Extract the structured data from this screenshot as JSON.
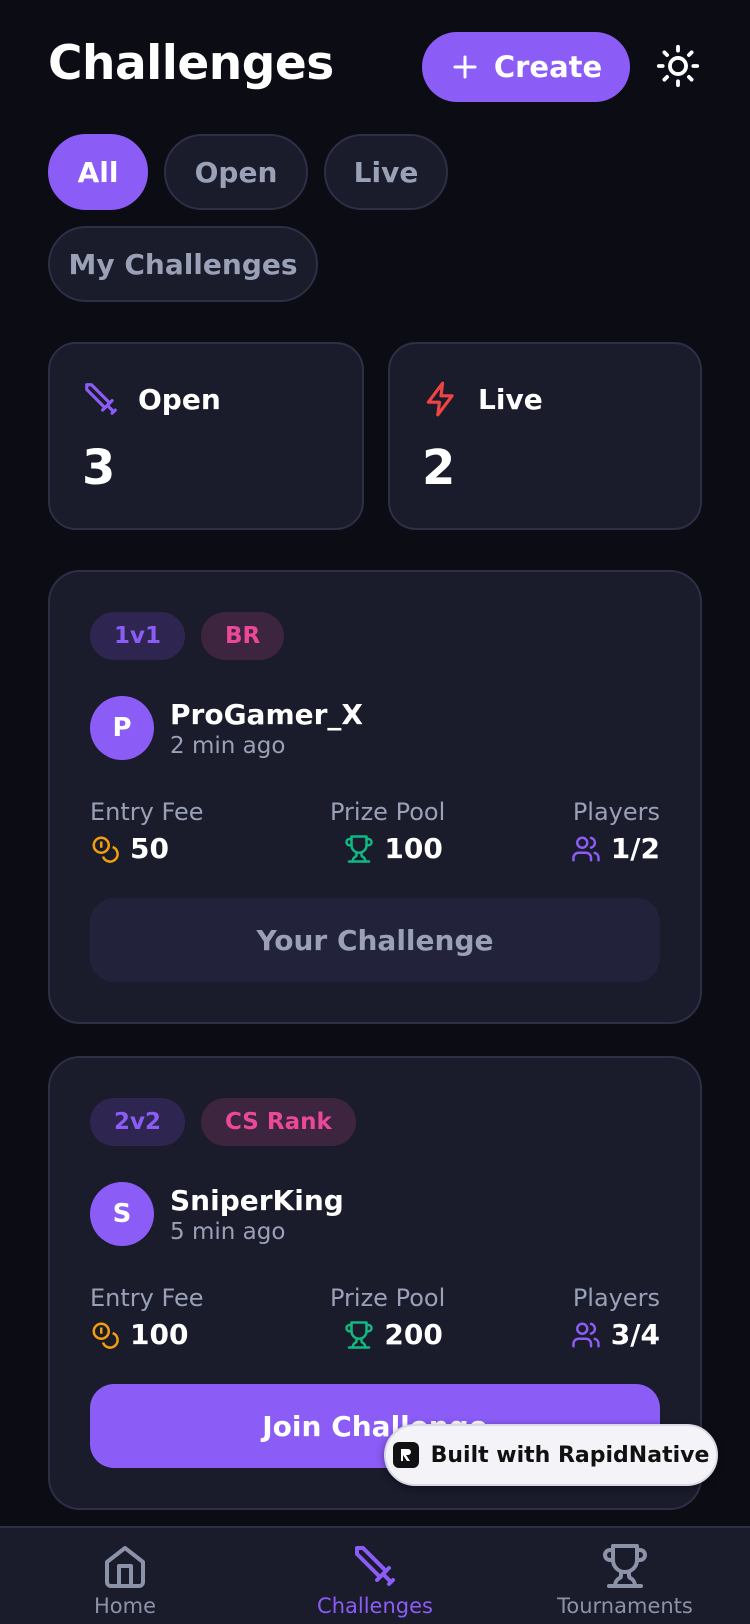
{
  "header": {
    "title": "Challenges",
    "create_label": "Create"
  },
  "filters": [
    "All",
    "Open",
    "Live",
    "My Challenges"
  ],
  "stats": {
    "open": {
      "label": "Open",
      "value": "3"
    },
    "live": {
      "label": "Live",
      "value": "2"
    }
  },
  "labels": {
    "entry_fee": "Entry Fee",
    "prize_pool": "Prize Pool",
    "players": "Players"
  },
  "challenges": [
    {
      "mode": "1v1",
      "game": "BR",
      "avatar_letter": "P",
      "host": "ProGamer_X",
      "time": "2 min ago",
      "entry_fee": "50",
      "prize_pool": "100",
      "players": "1/2",
      "action": "Your Challenge"
    },
    {
      "mode": "2v2",
      "game": "CS Rank",
      "avatar_letter": "S",
      "host": "SniperKing",
      "time": "5 min ago",
      "entry_fee": "100",
      "prize_pool": "200",
      "players": "3/4",
      "action": "Join Challenge"
    }
  ],
  "badge": "Built with RapidNative",
  "tabs": [
    "Home",
    "Challenges",
    "Tournaments"
  ],
  "colors": {
    "accent": "#8b5cf6",
    "live": "#ef4444",
    "coin": "#f59e0b",
    "trophy": "#10b981",
    "tag_game": "#ec4899"
  }
}
